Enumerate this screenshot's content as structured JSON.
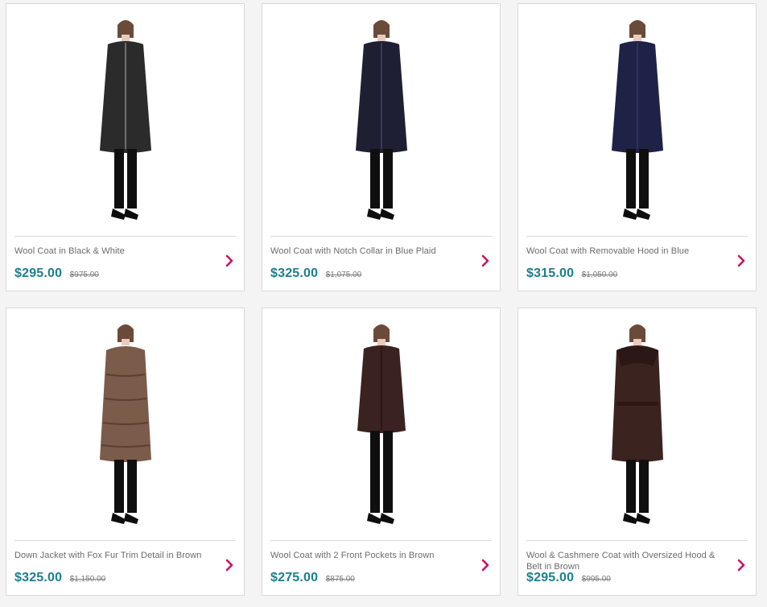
{
  "products": [
    {
      "title": "Wool Coat in Black & White",
      "sale_price": "$295.00",
      "original_price": "$975.00",
      "coat_color": "#2b2b2b",
      "accent": "#6e6e6e"
    },
    {
      "title": "Wool Coat with Notch Collar in Blue Plaid",
      "sale_price": "$325.00",
      "original_price": "$1,075.00",
      "coat_color": "#1f1f33",
      "accent": "#3a3a5a"
    },
    {
      "title": "Wool Coat with Removable Hood in Blue",
      "sale_price": "$315.00",
      "original_price": "$1,050.00",
      "coat_color": "#1e2246",
      "accent": "#2d3262"
    },
    {
      "title": "Down Jacket with Fox Fur Trim Detail in Brown",
      "sale_price": "$325.00",
      "original_price": "$1,150.00",
      "coat_color": "#7b5b49",
      "accent": "#5a3f33"
    },
    {
      "title": "Wool Coat with 2 Front Pockets in Brown",
      "sale_price": "$275.00",
      "original_price": "$875.00",
      "coat_color": "#3a2220",
      "accent": "#2a1817"
    },
    {
      "title": "Wool & Cashmere Coat with Oversized Hood & Belt in Brown",
      "sale_price": "$295.00",
      "original_price": "$995.00",
      "coat_color": "#3b2320",
      "accent": "#2b1715"
    }
  ],
  "theme": {
    "price_color": "#1b7f8f",
    "arrow_color": "#c7145f"
  },
  "icons": {
    "next_arrow_icon": "chevron-right-icon"
  }
}
